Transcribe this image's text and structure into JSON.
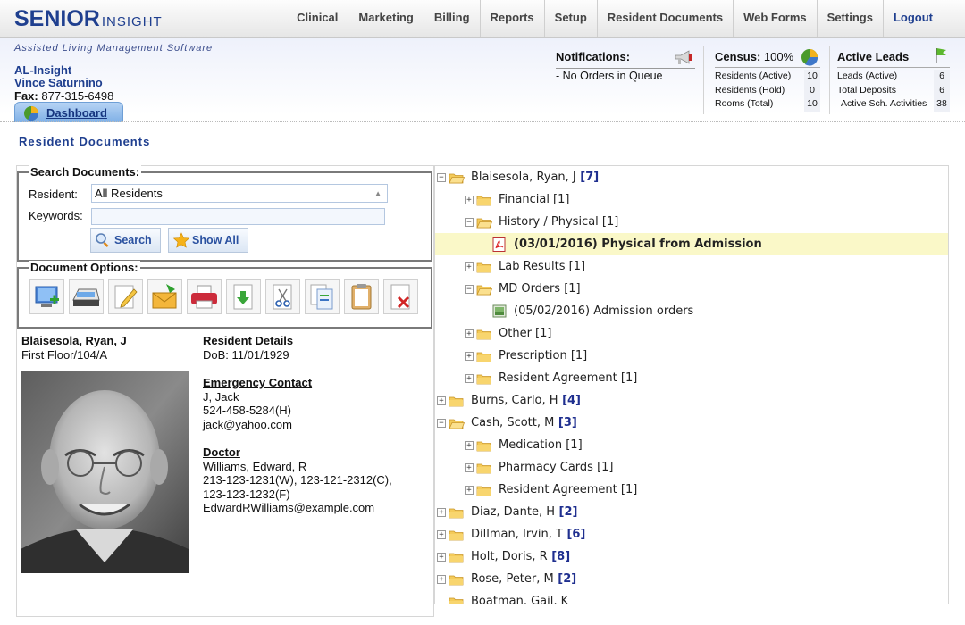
{
  "brand": {
    "name_bold": "SENIOR",
    "name_light": "INSIGHT"
  },
  "nav": [
    {
      "label": "Clinical"
    },
    {
      "label": "Marketing"
    },
    {
      "label": "Billing"
    },
    {
      "label": "Reports"
    },
    {
      "label": "Setup"
    },
    {
      "label": "Resident Documents"
    },
    {
      "label": "Web Forms"
    },
    {
      "label": "Settings"
    },
    {
      "label": "Logout"
    }
  ],
  "header": {
    "tagline": "Assisted Living Management Software",
    "company": "AL-Insight",
    "user": "Vince Saturnino",
    "fax_label": "Fax:",
    "fax": "877-315-6498",
    "dashboard_tab": "Dashboard"
  },
  "notifications": {
    "title": "Notifications:",
    "message": "- No Orders in Queue"
  },
  "census": {
    "title": "Census:",
    "percent": "100%",
    "rows": [
      {
        "label": "Residents (Active)",
        "value": "10"
      },
      {
        "label": "Residents (Hold)",
        "value": "0"
      },
      {
        "label": "Rooms (Total)",
        "value": "10"
      }
    ]
  },
  "leads": {
    "title": "Active Leads",
    "rows": [
      {
        "label": "Leads (Active)",
        "value": "6"
      },
      {
        "label": "Total Deposits",
        "value": "6"
      },
      {
        "label": "Active Sch. Activities",
        "value": "38"
      }
    ]
  },
  "page_title": "Resident Documents",
  "search": {
    "legend": "Search Documents:",
    "resident_label": "Resident:",
    "resident_value": "All Residents",
    "keywords_label": "Keywords:",
    "keywords_value": "",
    "search_btn": "Search",
    "showall_btn": "Show All"
  },
  "doc_options": {
    "legend": "Document Options:",
    "tools": [
      "add-document-icon",
      "scanner-icon",
      "edit-document-icon",
      "email-document-icon",
      "print-icon",
      "download-icon",
      "cut-icon",
      "copy-icon",
      "paste-icon",
      "delete-document-icon"
    ]
  },
  "resident": {
    "name": "Blaisesola, Ryan, J",
    "location": "First Floor/104/A",
    "details_title": "Resident Details",
    "dob": "DoB: 11/01/1929",
    "emergency_title": "Emergency Contact",
    "emergency": [
      "J, Jack",
      "524-458-5284(H)",
      "jack@yahoo.com"
    ],
    "doctor_title": "Doctor",
    "doctor": [
      "Williams, Edward, R",
      "213-123-1231(W), 123-121-2312(C),",
      "123-123-1232(F)",
      "EdwardRWilliams@example.com"
    ]
  },
  "tree": [
    {
      "level": 0,
      "toggle": "-",
      "type": "folder-open",
      "label": "Blaisesola, Ryan, J",
      "count": "[7]"
    },
    {
      "level": 1,
      "toggle": "+",
      "type": "folder",
      "label": "Financial [1]"
    },
    {
      "level": 1,
      "toggle": "-",
      "type": "folder-open",
      "label": "History / Physical [1]"
    },
    {
      "level": 2,
      "toggle": "",
      "type": "pdf",
      "label": "(03/01/2016) Physical from Admission",
      "selected": true
    },
    {
      "level": 1,
      "toggle": "+",
      "type": "folder",
      "label": "Lab Results [1]"
    },
    {
      "level": 1,
      "toggle": "-",
      "type": "folder-open",
      "label": "MD Orders [1]"
    },
    {
      "level": 2,
      "toggle": "",
      "type": "image",
      "label": "(05/02/2016) Admission orders"
    },
    {
      "level": 1,
      "toggle": "+",
      "type": "folder",
      "label": "Other [1]"
    },
    {
      "level": 1,
      "toggle": "+",
      "type": "folder",
      "label": "Prescription [1]"
    },
    {
      "level": 1,
      "toggle": "+",
      "type": "folder",
      "label": "Resident Agreement [1]"
    },
    {
      "level": 0,
      "toggle": "+",
      "type": "folder",
      "label": "Burns, Carlo, H",
      "count": "[4]"
    },
    {
      "level": 0,
      "toggle": "-",
      "type": "folder-open",
      "label": "Cash, Scott, M",
      "count": "[3]"
    },
    {
      "level": 1,
      "toggle": "+",
      "type": "folder",
      "label": "Medication [1]"
    },
    {
      "level": 1,
      "toggle": "+",
      "type": "folder",
      "label": "Pharmacy Cards [1]"
    },
    {
      "level": 1,
      "toggle": "+",
      "type": "folder",
      "label": "Resident Agreement [1]"
    },
    {
      "level": 0,
      "toggle": "+",
      "type": "folder",
      "label": "Diaz, Dante, H",
      "count": "[2]"
    },
    {
      "level": 0,
      "toggle": "+",
      "type": "folder",
      "label": "Dillman, Irvin, T",
      "count": "[6]"
    },
    {
      "level": 0,
      "toggle": "+",
      "type": "folder",
      "label": "Holt, Doris, R",
      "count": "[8]"
    },
    {
      "level": 0,
      "toggle": "+",
      "type": "folder",
      "label": "Rose, Peter, M",
      "count": "[2]"
    },
    {
      "level": 0,
      "toggle": "",
      "type": "folder",
      "label": "Boatman, Gail, K"
    }
  ]
}
